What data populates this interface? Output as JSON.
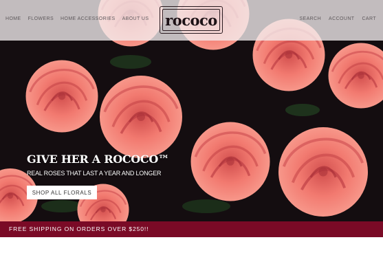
{
  "header": {
    "nav_left": [
      "HOME",
      "FLOWERS",
      "HOME ACCESSORIES",
      "ABOUT US"
    ],
    "nav_right": [
      "SEARCH",
      "ACCOUNT",
      "CART"
    ],
    "logo_text": "rococo"
  },
  "hero": {
    "title": "GIVE HER A ROCOCO™",
    "subtitle": "REAL ROSES THAT LAST A YEAR AND LONGER",
    "cta_label": "SHOP ALL FLORALS"
  },
  "banner": {
    "text": "FREE SHIPPING ON ORDERS OVER $250!!"
  },
  "colors": {
    "banner_bg": "#7a0a26",
    "rose_pink": "#f0776f",
    "background_dark": "#140d10"
  }
}
